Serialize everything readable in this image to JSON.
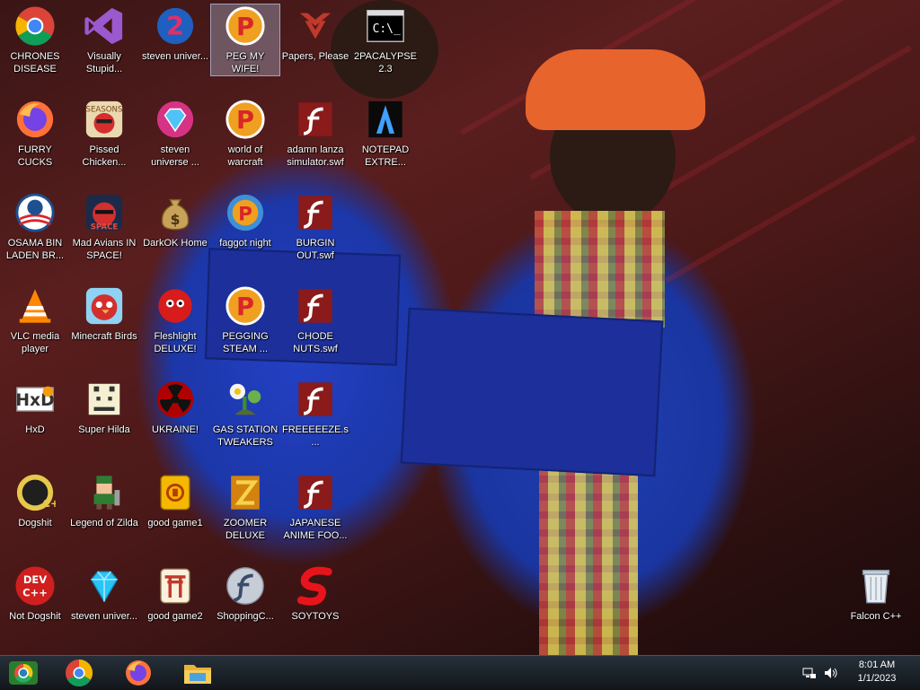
{
  "desktop": {
    "icons": [
      {
        "label": "CHRONES DISEASE",
        "icon": "chrome-icon"
      },
      {
        "label": "Visually Stupid...",
        "icon": "visual-studio-icon"
      },
      {
        "label": "steven univer...",
        "icon": "steven-universe-2-icon"
      },
      {
        "label": "PEG MY WIFE!",
        "icon": "peggle-icon",
        "selected": true
      },
      {
        "label": "Papers, Please",
        "icon": "papers-please-icon"
      },
      {
        "label": "2PACALYPSE 2.3",
        "icon": "terminal-icon"
      },
      {
        "label": "FURRY CUCKS",
        "icon": "firefox-icon"
      },
      {
        "label": "Pissed Chicken...",
        "icon": "angry-birds-seasons-icon"
      },
      {
        "label": "steven universe ...",
        "icon": "gem-icon"
      },
      {
        "label": "world of warcraft",
        "icon": "peggle-icon"
      },
      {
        "label": "adamn lanza simulator.swf",
        "icon": "flash-file-icon"
      },
      {
        "label": "NOTEPAD EXTRE...",
        "icon": "notepad-extreme-icon"
      },
      {
        "label": "OSAMA BIN LADEN BR...",
        "icon": "obama-logo-icon"
      },
      {
        "label": "Mad Avians IN SPACE!",
        "icon": "angry-birds-space-icon"
      },
      {
        "label": "DarkOK Home",
        "icon": "money-bag-icon"
      },
      {
        "label": "faggot night",
        "icon": "peggle-nights-icon"
      },
      {
        "label": "BURGIN OUT.swf",
        "icon": "flash-file-icon"
      },
      {
        "label": "VLC media player",
        "icon": "vlc-icon"
      },
      {
        "label": "Minecraft Birds",
        "icon": "angry-birds-icon"
      },
      {
        "label": "Fleshlight DELUXE!",
        "icon": "red-fuzzball-icon"
      },
      {
        "label": "PEGGING STEAM ...",
        "icon": "peggle-icon"
      },
      {
        "label": "CHODE NUTS.swf",
        "icon": "flash-file-icon"
      },
      {
        "label": "HxD",
        "icon": "hxd-icon"
      },
      {
        "label": "Super Hilda",
        "icon": "pixel-cat-icon"
      },
      {
        "label": "UKRAINE!",
        "icon": "radiation-icon"
      },
      {
        "label": "GAS STATION TWEAKERS",
        "icon": "flowers-icon"
      },
      {
        "label": "FREEEEEZE.s...",
        "icon": "flash-file-icon"
      },
      {
        "label": "Dogshit",
        "icon": "cpp-logo-icon"
      },
      {
        "label": "Legend of Zilda",
        "icon": "pixel-character-icon"
      },
      {
        "label": "good game1",
        "icon": "mahjong-tile-icon"
      },
      {
        "label": "ZOOMER DELUXE",
        "icon": "zuma-icon"
      },
      {
        "label": "JAPANESE ANIME FOO...",
        "icon": "flash-file-icon"
      },
      {
        "label": "Not Dogshit",
        "icon": "dev-cpp-icon"
      },
      {
        "label": "steven univer...",
        "icon": "diamond-icon"
      },
      {
        "label": "good game2",
        "icon": "torii-tile-icon"
      },
      {
        "label": "ShoppingC...",
        "icon": "flash-player-icon"
      },
      {
        "label": "SOYTOYS",
        "icon": "s-logo-icon"
      },
      {
        "label": "Falcon C++",
        "icon": "recycle-bin-icon"
      }
    ]
  },
  "taskbar": {
    "pinned": [
      {
        "name": "start-button"
      },
      {
        "name": "chrome-taskbar-button"
      },
      {
        "name": "firefox-taskbar-button"
      },
      {
        "name": "file-explorer-taskbar-button"
      }
    ],
    "clock": {
      "time": "8:01 AM",
      "date": "1/1/2023"
    }
  },
  "colors": {
    "taskbar": "#1b2229",
    "flash_red": "#8b1a1a",
    "peggle_orange": "#f0a020"
  }
}
